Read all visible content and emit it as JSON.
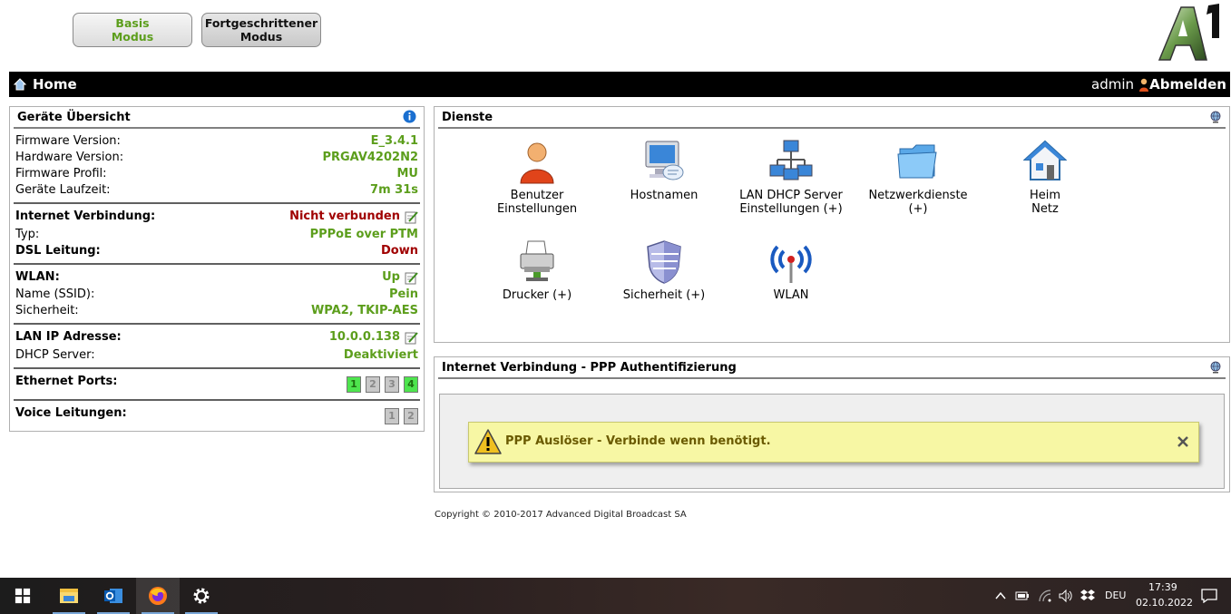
{
  "modes": {
    "basic_line1": "Basis",
    "basic_line2": "Modus",
    "advanced_line1": "Fortgeschrittener",
    "advanced_line2": "Modus"
  },
  "header": {
    "home": "Home",
    "user": "admin",
    "logout": "Abmelden"
  },
  "overview": {
    "title": "Geräte Übersicht",
    "firmware_version_label": "Firmware Version:",
    "firmware_version": "E_3.4.1",
    "hardware_version_label": "Hardware Version:",
    "hardware_version": "PRGAV4202N2",
    "firmware_profile_label": "Firmware Profil:",
    "firmware_profile": "MU",
    "uptime_label": "Geräte Laufzeit:",
    "uptime": "7m 31s",
    "internet_label": "Internet Verbindung:",
    "internet_status": "Nicht verbunden",
    "type_label": "Typ:",
    "type": "PPPoE over PTM",
    "dsl_label": "DSL Leitung:",
    "dsl_status": "Down",
    "wlan_label": "WLAN:",
    "wlan_status": "Up",
    "ssid_label": "Name (SSID):",
    "ssid": "Pein",
    "security_label": "Sicherheit:",
    "security": "WPA2, TKIP-AES",
    "lan_ip_label": "LAN IP Adresse:",
    "lan_ip": "10.0.0.138",
    "dhcp_label": "DHCP Server:",
    "dhcp": "Deaktiviert",
    "ethernet_label": "Ethernet Ports:",
    "ethernet_ports": [
      "1",
      "2",
      "3",
      "4"
    ],
    "voice_label": "Voice Leitungen:",
    "voice_ports": [
      "1",
      "2"
    ]
  },
  "services": {
    "title": "Dienste",
    "items": [
      {
        "line1": "Benutzer",
        "line2": "Einstellungen"
      },
      {
        "line1": "Hostnamen",
        "line2": ""
      },
      {
        "line1": "LAN DHCP Server",
        "line2": "Einstellungen (+)"
      },
      {
        "line1": "Netzwerkdienste",
        "line2": "(+)"
      },
      {
        "line1": "Heim",
        "line2": "Netz"
      },
      {
        "line1": "Drucker (+)",
        "line2": ""
      },
      {
        "line1": "Sicherheit (+)",
        "line2": ""
      },
      {
        "line1": "WLAN",
        "line2": ""
      }
    ]
  },
  "ppp": {
    "title": "Internet Verbindung - PPP Authentifizierung",
    "message": "PPP Auslöser - Verbinde wenn benötigt."
  },
  "footer": {
    "copyright": "Copyright © 2010-2017 Advanced Digital Broadcast SA"
  },
  "taskbar": {
    "language": "DEU",
    "time": "17:39",
    "date": "02.10.2022"
  },
  "colors": {
    "green_value": "#5c9e1c",
    "red_value": "#a00000",
    "alert_bg": "#f7f7a4"
  }
}
